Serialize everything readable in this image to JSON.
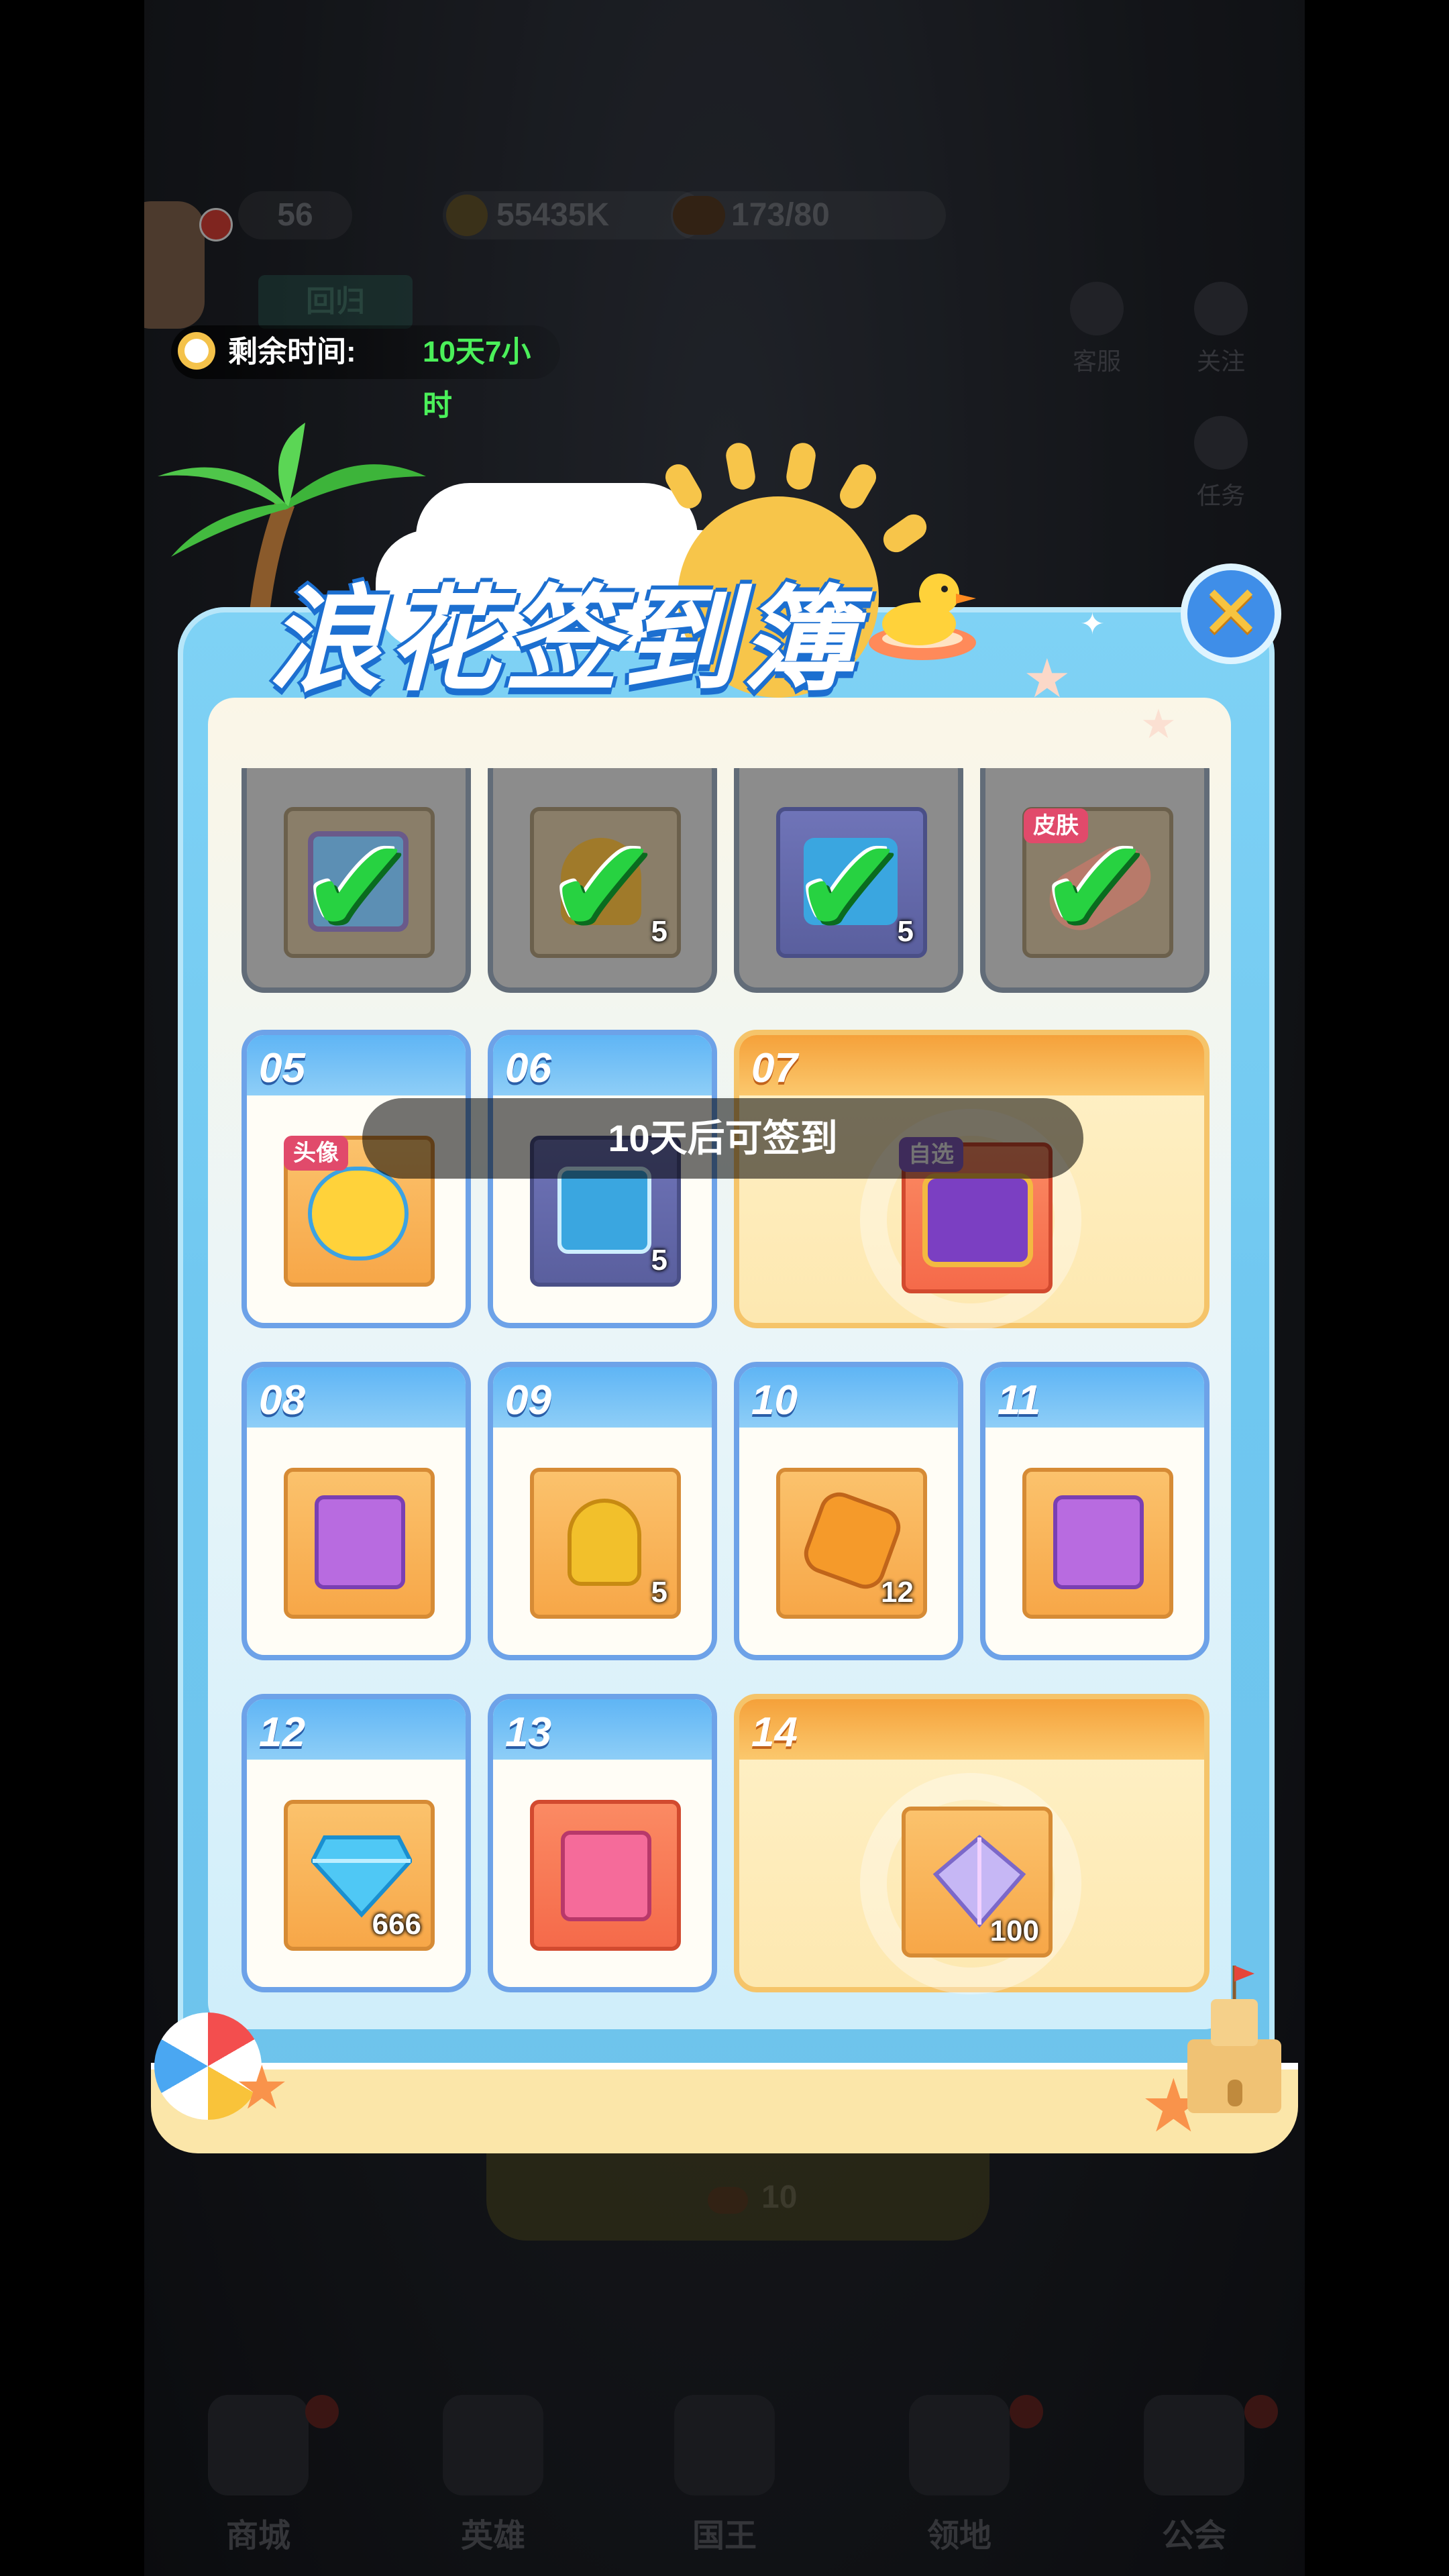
{
  "hud": {
    "level": "56",
    "gold": "55435K",
    "stamina": "173/80",
    "faded_tag": "回归",
    "timer_label": "剩余时间:",
    "timer_value": "10天7小时"
  },
  "side_buttons": [
    "客服",
    "关注",
    "任务"
  ],
  "title": "浪花签到簿",
  "toast": "10天后可签到",
  "claimed_days": [
    {
      "item": "photo-frame-icon",
      "qty": "",
      "tag": ""
    },
    {
      "item": "shovel-icon",
      "qty": "5",
      "tag": ""
    },
    {
      "item": "blue-chest-icon",
      "qty": "5",
      "tag": ""
    },
    {
      "item": "surfboard-icon",
      "qty": "",
      "tag": "皮肤"
    }
  ],
  "days": [
    {
      "day": "05",
      "item": "duck-avatar-icon",
      "qty": "",
      "tag": "头像"
    },
    {
      "day": "06",
      "item": "blue-chest-icon",
      "qty": "5",
      "tag": ""
    },
    {
      "day": "07",
      "item": "purple-treasure-chest-icon",
      "qty": "",
      "tag": "自选"
    },
    {
      "day": "08",
      "item": "purple-gift-box-icon",
      "qty": "",
      "tag": ""
    },
    {
      "day": "09",
      "item": "gold-shovel-icon",
      "qty": "5",
      "tag": ""
    },
    {
      "day": "10",
      "item": "amber-crystal-icon",
      "qty": "12",
      "tag": ""
    },
    {
      "day": "11",
      "item": "purple-gift-box-icon",
      "qty": "",
      "tag": ""
    },
    {
      "day": "12",
      "item": "diamond-icon",
      "qty": "666",
      "tag": ""
    },
    {
      "day": "13",
      "item": "pink-gift-box-icon",
      "qty": "",
      "tag": ""
    },
    {
      "day": "14",
      "item": "rainbow-crystal-icon",
      "qty": "100",
      "tag": ""
    }
  ],
  "behind_panel": {
    "button_cost": "10"
  },
  "bottom_nav": [
    "商城",
    "英雄",
    "国王",
    "领地",
    "公会"
  ],
  "colors": {
    "card_border": "#6da2e8",
    "big_card": "#f5c46a",
    "check": "#27d241",
    "timer_value": "#4bf05a"
  }
}
